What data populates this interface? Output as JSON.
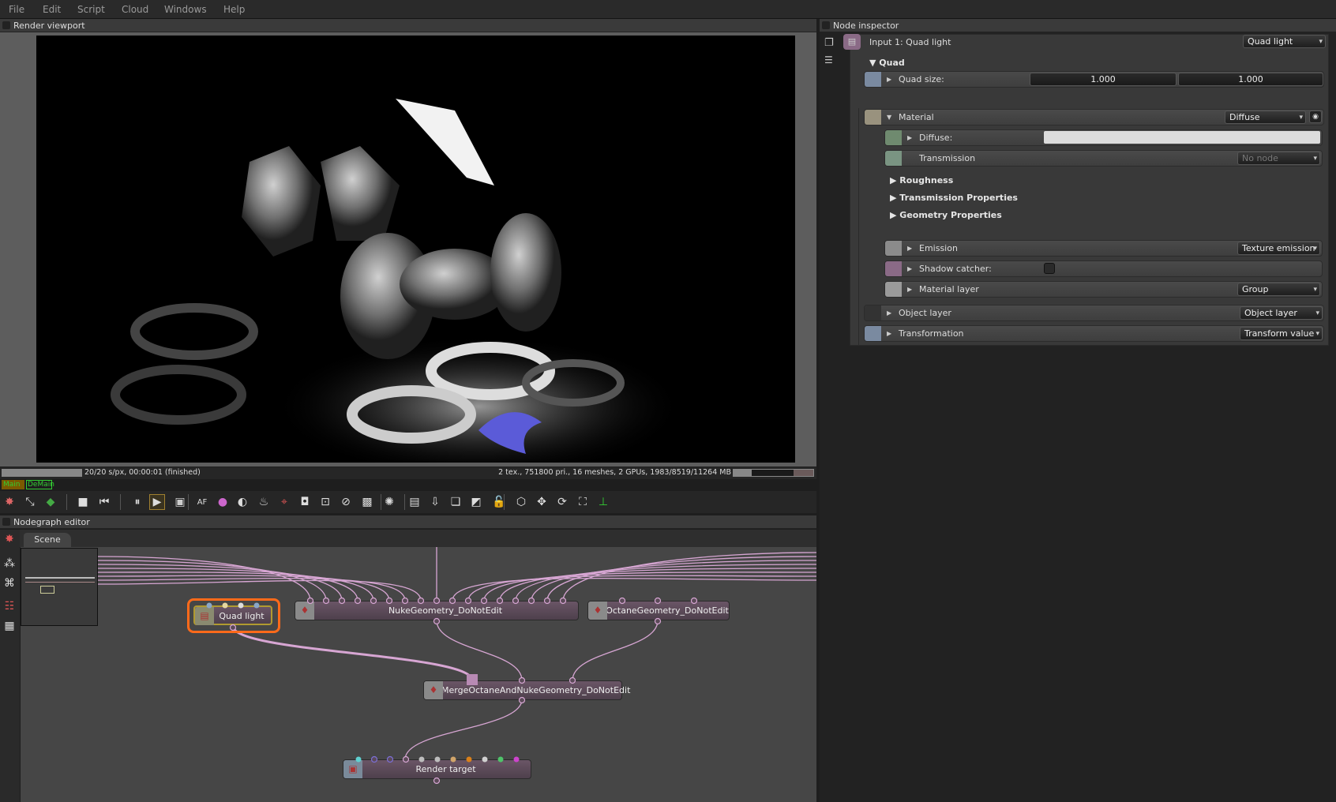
{
  "menu": [
    "File",
    "Edit",
    "Script",
    "Cloud",
    "Windows",
    "Help"
  ],
  "viewport": {
    "title": "Render viewport",
    "status_left": "20/20 s/px, 00:00:01 (finished)",
    "status_right": "2 tex., 751800 pri., 16 meshes, 2 GPUs, 1983/8519/11264 MB",
    "render_progress": 1.0,
    "memory_usage_fraction": 0.23,
    "tags": [
      "Main",
      "DeMain"
    ],
    "toolbar_icons": [
      "recenter-icon",
      "fit-icon",
      "cube-color-icon",
      "stop-icon",
      "restart-icon",
      "pause-icon",
      "play-icon",
      "region-icon",
      "af-icon",
      "color-wheel-icon",
      "sphere-pick-icon",
      "material-pick-icon",
      "object-pick-icon",
      "focus-pick-icon",
      "zoom-pick-icon",
      "lens-icon",
      "checker-icon",
      "gauge-icon",
      "clipboard-icon",
      "export-icon",
      "layers-icon",
      "image-compare-icon",
      "lock-icon",
      "box-icon",
      "move-icon",
      "rotate-icon",
      "fullscreen-icon",
      "axis-icon"
    ]
  },
  "nodegraph": {
    "title": "Nodegraph editor",
    "tab": "Scene",
    "nodes": {
      "quad": "Quad light",
      "nuke": "NukeGeometry_DoNotEdit",
      "octane": "OctaneGeometry_DoNotEdit",
      "merge": "MergeOctaneAndNukeGeometry_DoNotEdit",
      "render": "Render target"
    },
    "selected": "Quad light",
    "colors": {
      "wire": "#d7a6d3",
      "selection": "#ff6a1a",
      "node": "#5b4a58"
    },
    "render_port_colors": [
      "#5fd0d0",
      "#7b6fd6",
      "#7b6fd6",
      "#d7a6d3",
      "#bdbdbd",
      "#bdbdbd",
      "#d1a56a",
      "#d9801a",
      "#d0d0d0",
      "#4fc46a",
      "#cc44cc"
    ],
    "quad_port_colors": [
      "#8aa6c8",
      "#e6d7a0",
      "#dddddd",
      "#8aa6c8"
    ]
  },
  "inspector": {
    "title": "Node inspector",
    "input_label": "Input 1: Quad light",
    "input_type": "Quad light",
    "quad_section": "Quad",
    "quad_size_label": "Quad size:",
    "quad_size": [
      "1.000",
      "1.000"
    ],
    "material_label": "Material",
    "material_type": "Diffuse",
    "diffuse_label": "Diffuse:",
    "diffuse_color": "#dcdcdc",
    "transmission_label": "Transmission",
    "transmission_value": "No node",
    "sections": [
      "Roughness",
      "Transmission Properties",
      "Geometry Properties"
    ],
    "emission_label": "Emission",
    "emission_value": "Texture emission",
    "shadow_label": "Shadow catcher:",
    "shadow_checked": false,
    "matlayer_label": "Material layer",
    "matlayer_value": "Group",
    "objlayer_label": "Object layer",
    "objlayer_value": "Object layer",
    "transform_label": "Transformation",
    "transform_value": "Transform value"
  }
}
